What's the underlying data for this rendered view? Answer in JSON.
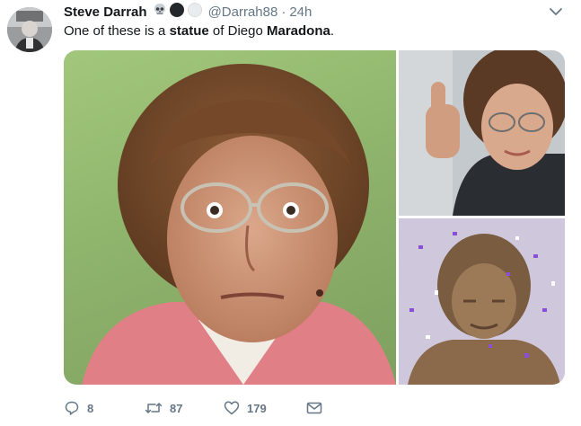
{
  "tweet": {
    "author_name": "Steve Darrah",
    "name_emojis": [
      "skull-emoji",
      "black-circle-emoji",
      "white-circle-emoji"
    ],
    "handle": "@Darrah88",
    "separator": "·",
    "time": "24h",
    "text_parts": {
      "p1": "One of these is a ",
      "bold1": "statue",
      "p2": " of Diego ",
      "bold2": "Maradona",
      "p3": "."
    },
    "media": [
      {
        "subject": "woman-with-curly-hair-and-glasses-photo"
      },
      {
        "subject": "woman-giving-thumbs-up-photo"
      },
      {
        "subject": "bronze-statue-with-confetti-photo"
      }
    ]
  },
  "actions": {
    "reply_count": "8",
    "retweet_count": "87",
    "like_count": "179"
  },
  "colors": {
    "text": "#14171a",
    "muted": "#657786",
    "background": "#ffffff"
  }
}
